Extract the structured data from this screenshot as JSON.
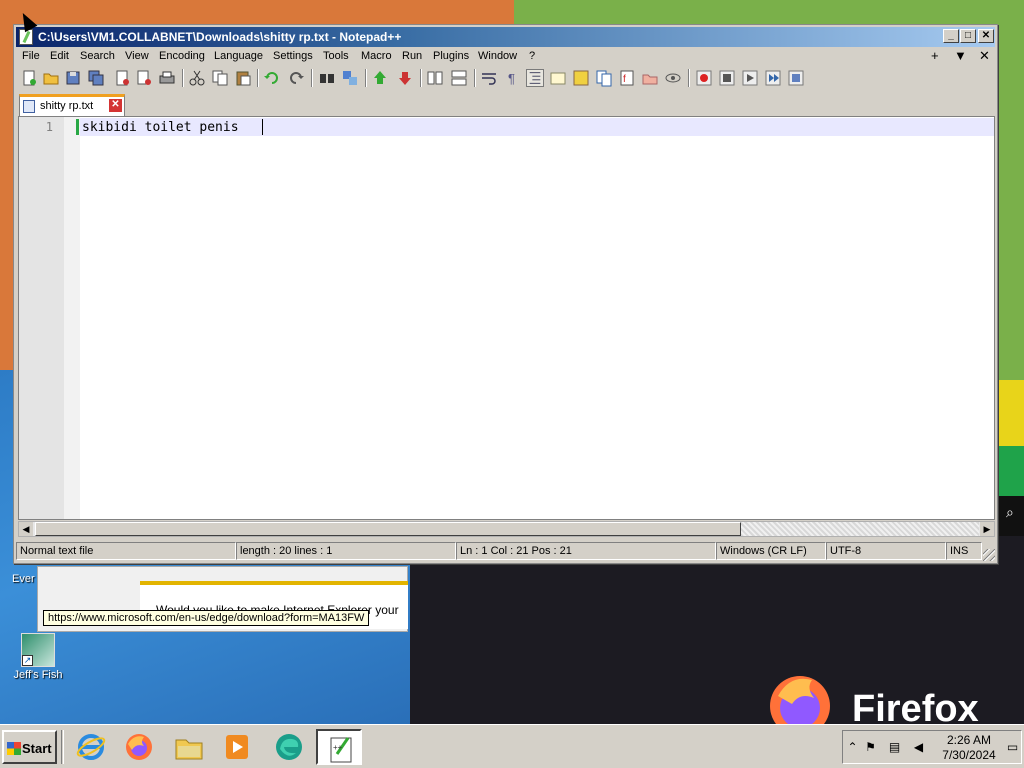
{
  "window": {
    "title": "C:\\Users\\VM1.COLLABNET\\Downloads\\shitty rp.txt - Notepad++",
    "minimize": "_",
    "maximize": "□",
    "close": "✕"
  },
  "menu": {
    "items": [
      "File",
      "Edit",
      "Search",
      "View",
      "Encoding",
      "Language",
      "Settings",
      "Tools",
      "Macro",
      "Run",
      "Plugins",
      "Window",
      "?"
    ],
    "right": [
      "+",
      "▼",
      "✕"
    ]
  },
  "toolbar": {
    "buttons": [
      "new-icon",
      "open-icon",
      "save-icon",
      "save-all-icon",
      "close-icon",
      "close-all-icon",
      "print-icon",
      "cut-icon",
      "copy-icon",
      "paste-icon",
      "undo-icon",
      "redo-icon",
      "find-icon",
      "replace-icon",
      "zoom-in-icon",
      "zoom-out-icon",
      "sync-vertical-icon",
      "sync-horizontal-icon",
      "word-wrap-icon",
      "show-all-chars-icon",
      "indent-guide-icon",
      "udl-icon",
      "doc-map-icon",
      "doc-list-icon",
      "function-list-icon",
      "folder-workspace-icon",
      "monitoring-icon",
      "record-macro-icon",
      "stop-record-icon",
      "play-macro-icon",
      "run-macro-multiple-icon",
      "save-macro-icon"
    ]
  },
  "tab": {
    "label": "shitty rp.txt",
    "close": "✕"
  },
  "editor": {
    "line_number": "1",
    "text": "skibidi toilet penis"
  },
  "status": {
    "file_type": "Normal text file",
    "length": "length : 20    lines : 1",
    "position": "Ln : 1    Col : 21    Pos : 21",
    "eol": "Windows (CR LF)",
    "encoding": "UTF-8",
    "mode": "INS"
  },
  "desktop": {
    "icon_jeffs_fish": "Jeff's Fish",
    "partial_label": "Ever",
    "ie_prompt": "Would you like to make Internet Explorer your",
    "url_tooltip": "https://www.microsoft.com/en-us/edge/download?form=MA13FW",
    "firefox_wordmark": "Firefox"
  },
  "taskbar": {
    "start": "Start",
    "apps": [
      "internet-explorer-icon",
      "firefox-icon",
      "file-explorer-icon",
      "media-player-icon",
      "edge-icon",
      "notepad-plus-plus-icon"
    ],
    "time": "2:26 AM",
    "date": "7/30/2024"
  },
  "colors": {
    "title_active": "#0a246a",
    "current_line": "#e8e8ff",
    "tab_accent": "#f0a020",
    "change_marker": "#28a845"
  }
}
